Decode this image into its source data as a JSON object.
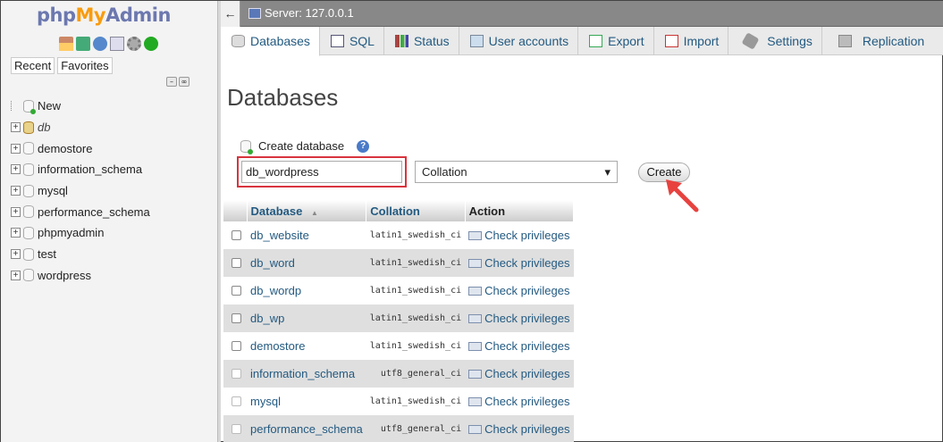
{
  "nav": {
    "logo": {
      "php": "php",
      "my": "My",
      "admin": "Admin"
    },
    "icons": [
      "home-icon",
      "exit-icon",
      "help-icon",
      "docs-icon",
      "settings-icon",
      "reload-icon"
    ],
    "recent_label": "Recent",
    "favorites_label": "Favorites",
    "tree": [
      {
        "label": "New",
        "type": "new"
      },
      {
        "label": "db",
        "type": "open"
      },
      {
        "label": "demostore",
        "type": "db"
      },
      {
        "label": "information_schema",
        "type": "db"
      },
      {
        "label": "mysql",
        "type": "db"
      },
      {
        "label": "performance_schema",
        "type": "db"
      },
      {
        "label": "phpmyadmin",
        "type": "db"
      },
      {
        "label": "test",
        "type": "db"
      },
      {
        "label": "wordpress",
        "type": "db"
      }
    ]
  },
  "topbar": {
    "back_glyph": "←",
    "server_label": "Server: 127.0.0.1"
  },
  "tabs": [
    {
      "label": "Databases",
      "active": true
    },
    {
      "label": "SQL"
    },
    {
      "label": "Status"
    },
    {
      "label": "User accounts"
    },
    {
      "label": "Export"
    },
    {
      "label": "Import"
    },
    {
      "label": "Settings"
    },
    {
      "label": "Replication"
    }
  ],
  "main": {
    "title": "Databases",
    "create_label": "Create database",
    "help_glyph": "?",
    "dbname_value": "db_wordpress",
    "collation_value": "Collation",
    "create_button": "Create"
  },
  "table": {
    "headers": {
      "database": "Database",
      "sort_glyph": "▲",
      "collation": "Collation",
      "action": "Action"
    },
    "rows": [
      {
        "name": "db_website",
        "collation": "latin1_swedish_ci",
        "action": "Check privileges"
      },
      {
        "name": "db_word",
        "collation": "latin1_swedish_ci",
        "action": "Check privileges"
      },
      {
        "name": "db_wordp",
        "collation": "latin1_swedish_ci",
        "action": "Check privileges"
      },
      {
        "name": "db_wp",
        "collation": "latin1_swedish_ci",
        "action": "Check privileges"
      },
      {
        "name": "demostore",
        "collation": "latin1_swedish_ci",
        "action": "Check privileges"
      },
      {
        "name": "information_schema",
        "collation": "utf8_general_ci",
        "action": "Check privileges"
      },
      {
        "name": "mysql",
        "collation": "latin1_swedish_ci",
        "action": "Check privileges"
      },
      {
        "name": "performance_schema",
        "collation": "utf8_general_ci",
        "action": "Check privileges"
      }
    ]
  },
  "colors": {
    "accent_link": "#235a81",
    "highlight_border": "#d9343e",
    "arrow": "#e8423f"
  }
}
